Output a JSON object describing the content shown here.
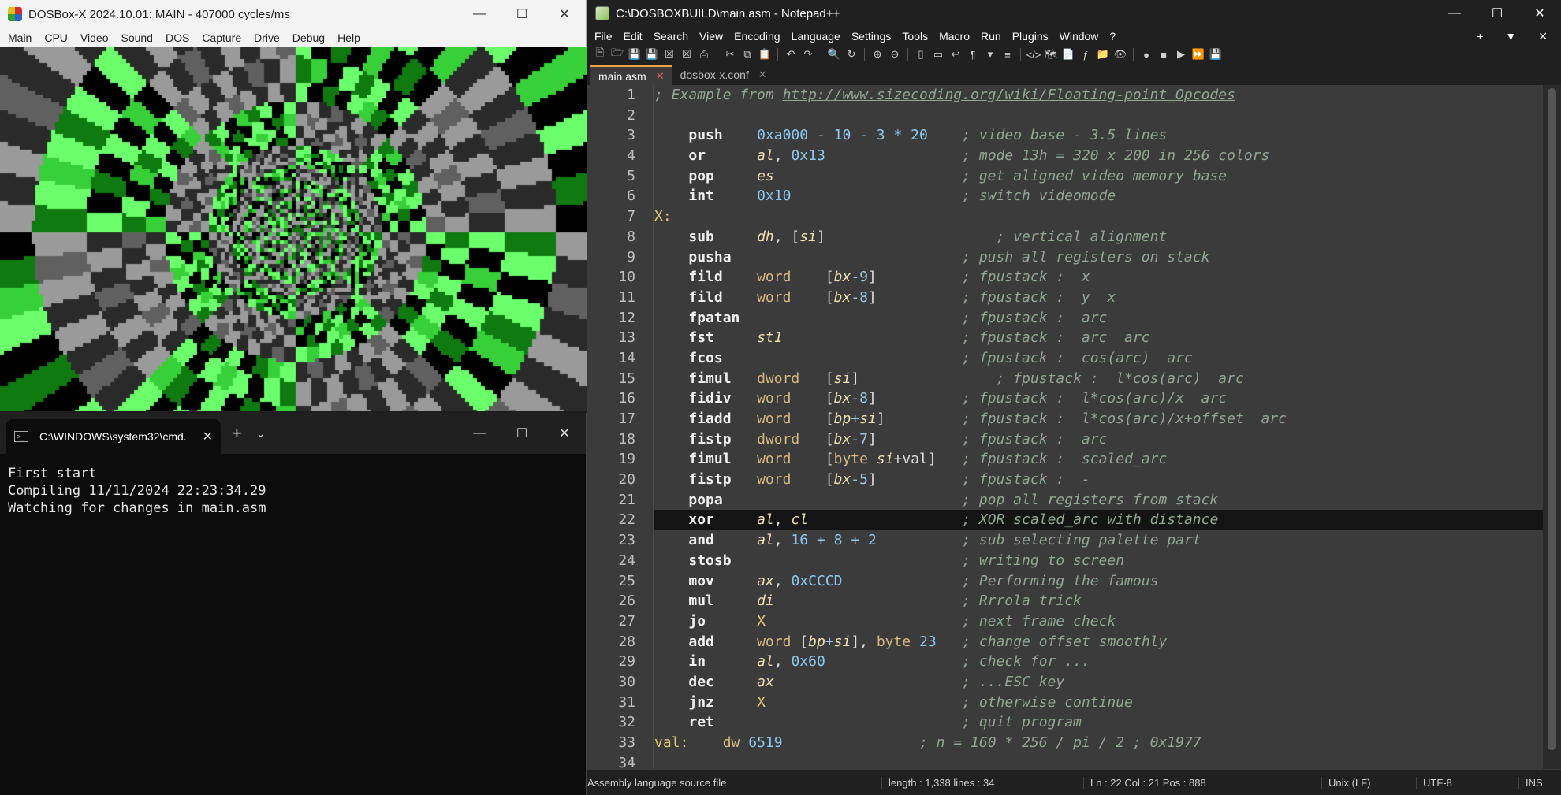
{
  "dosbox": {
    "title": "DOSBox-X 2024.10.01: MAIN - 407000 cycles/ms",
    "menu": [
      "Main",
      "CPU",
      "Video",
      "Sound",
      "DOS",
      "Capture",
      "Drive",
      "Debug",
      "Help"
    ],
    "screen_colors": [
      "#000000",
      "#2a2a2a",
      "#606060",
      "#9a9a9a",
      "#0f7a0f",
      "#38d038",
      "#6cff6c"
    ]
  },
  "cmd": {
    "tab_label": "C:\\WINDOWS\\system32\\cmd.",
    "lines": [
      "First start",
      "",
      "Compiling 11/11/2024 22:23:34.29",
      "Watching for changes in main.asm"
    ]
  },
  "npp": {
    "title": "C:\\DOSBOXBUILD\\main.asm - Notepad++",
    "menu": [
      "File",
      "Edit",
      "Search",
      "View",
      "Encoding",
      "Language",
      "Settings",
      "Tools",
      "Macro",
      "Run",
      "Plugins",
      "Window",
      "?"
    ],
    "tabs": [
      {
        "label": "main.asm",
        "active": true
      },
      {
        "label": "dosbox-x.conf",
        "active": false
      }
    ],
    "current_line": 22,
    "code": [
      [
        [
          "c-cm",
          "; Example from "
        ],
        [
          "c-link",
          "http://www.sizecoding.org/wiki/Floating-point_Opcodes"
        ]
      ],
      [],
      [
        [
          "c-plain",
          "    "
        ],
        [
          "c-ins",
          "push"
        ],
        [
          "c-plain",
          "    "
        ],
        [
          "c-num",
          "0xa000 - 10 - 3 * 20"
        ],
        [
          "c-plain",
          "    "
        ],
        [
          "c-cm",
          "; video base - 3.5 lines"
        ]
      ],
      [
        [
          "c-plain",
          "    "
        ],
        [
          "c-ins",
          "or"
        ],
        [
          "c-plain",
          "      "
        ],
        [
          "c-reg",
          "al"
        ],
        [
          "c-plain",
          ", "
        ],
        [
          "c-num",
          "0x13"
        ],
        [
          "c-plain",
          "                "
        ],
        [
          "c-cm",
          "; mode 13h = 320 x 200 in 256 colors"
        ]
      ],
      [
        [
          "c-plain",
          "    "
        ],
        [
          "c-ins",
          "pop"
        ],
        [
          "c-plain",
          "     "
        ],
        [
          "c-reg",
          "es"
        ],
        [
          "c-plain",
          "                      "
        ],
        [
          "c-cm",
          "; get aligned video memory base"
        ]
      ],
      [
        [
          "c-plain",
          "    "
        ],
        [
          "c-ins",
          "int"
        ],
        [
          "c-plain",
          "     "
        ],
        [
          "c-num",
          "0x10"
        ],
        [
          "c-plain",
          "                    "
        ],
        [
          "c-cm",
          "; switch videomode"
        ]
      ],
      [
        [
          "c-lbl",
          "X:"
        ]
      ],
      [
        [
          "c-plain",
          "    "
        ],
        [
          "c-ins",
          "sub"
        ],
        [
          "c-plain",
          "     "
        ],
        [
          "c-reg",
          "dh"
        ],
        [
          "c-plain",
          ", ["
        ],
        [
          "c-reg",
          "si"
        ],
        [
          "c-plain",
          "]                    "
        ],
        [
          "c-cm",
          "; vertical alignment"
        ]
      ],
      [
        [
          "c-plain",
          "    "
        ],
        [
          "c-ins",
          "pusha"
        ],
        [
          "c-plain",
          "                           "
        ],
        [
          "c-cm",
          "; push all registers on stack"
        ]
      ],
      [
        [
          "c-plain",
          "    "
        ],
        [
          "c-ins",
          "fild"
        ],
        [
          "c-plain",
          "    "
        ],
        [
          "c-kw",
          "word"
        ],
        [
          "c-plain",
          "    ["
        ],
        [
          "c-reg",
          "bx"
        ],
        [
          "c-op",
          "-9"
        ],
        [
          "c-plain",
          "]          "
        ],
        [
          "c-cm",
          "; fpustack :  x"
        ]
      ],
      [
        [
          "c-plain",
          "    "
        ],
        [
          "c-ins",
          "fild"
        ],
        [
          "c-plain",
          "    "
        ],
        [
          "c-kw",
          "word"
        ],
        [
          "c-plain",
          "    ["
        ],
        [
          "c-reg",
          "bx"
        ],
        [
          "c-op",
          "-8"
        ],
        [
          "c-plain",
          "]          "
        ],
        [
          "c-cm",
          "; fpustack :  y  x"
        ]
      ],
      [
        [
          "c-plain",
          "    "
        ],
        [
          "c-ins",
          "fpatan"
        ],
        [
          "c-plain",
          "                          "
        ],
        [
          "c-cm",
          "; fpustack :  arc"
        ]
      ],
      [
        [
          "c-plain",
          "    "
        ],
        [
          "c-ins",
          "fst"
        ],
        [
          "c-plain",
          "     "
        ],
        [
          "c-reg",
          "st1"
        ],
        [
          "c-plain",
          "                     "
        ],
        [
          "c-cm",
          "; fpustack :  arc  arc"
        ]
      ],
      [
        [
          "c-plain",
          "    "
        ],
        [
          "c-ins",
          "fcos"
        ],
        [
          "c-plain",
          "                            "
        ],
        [
          "c-cm",
          "; fpustack :  cos(arc)  arc"
        ]
      ],
      [
        [
          "c-plain",
          "    "
        ],
        [
          "c-ins",
          "fimul"
        ],
        [
          "c-plain",
          "   "
        ],
        [
          "c-kw",
          "dword"
        ],
        [
          "c-plain",
          "   ["
        ],
        [
          "c-reg",
          "si"
        ],
        [
          "c-plain",
          "]                "
        ],
        [
          "c-cm",
          "; fpustack :  l*cos(arc)  arc"
        ]
      ],
      [
        [
          "c-plain",
          "    "
        ],
        [
          "c-ins",
          "fidiv"
        ],
        [
          "c-plain",
          "   "
        ],
        [
          "c-kw",
          "word"
        ],
        [
          "c-plain",
          "    ["
        ],
        [
          "c-reg",
          "bx"
        ],
        [
          "c-op",
          "-8"
        ],
        [
          "c-plain",
          "]          "
        ],
        [
          "c-cm",
          "; fpustack :  l*cos(arc)/x  arc"
        ]
      ],
      [
        [
          "c-plain",
          "    "
        ],
        [
          "c-ins",
          "fiadd"
        ],
        [
          "c-plain",
          "   "
        ],
        [
          "c-kw",
          "word"
        ],
        [
          "c-plain",
          "    ["
        ],
        [
          "c-reg",
          "bp"
        ],
        [
          "c-op",
          "+"
        ],
        [
          "c-reg",
          "si"
        ],
        [
          "c-plain",
          "]         "
        ],
        [
          "c-cm",
          "; fpustack :  l*cos(arc)/x+offset  arc"
        ]
      ],
      [
        [
          "c-plain",
          "    "
        ],
        [
          "c-ins",
          "fistp"
        ],
        [
          "c-plain",
          "   "
        ],
        [
          "c-kw",
          "dword"
        ],
        [
          "c-plain",
          "   ["
        ],
        [
          "c-reg",
          "bx"
        ],
        [
          "c-op",
          "-7"
        ],
        [
          "c-plain",
          "]          "
        ],
        [
          "c-cm",
          "; fpustack :  arc"
        ]
      ],
      [
        [
          "c-plain",
          "    "
        ],
        [
          "c-ins",
          "fimul"
        ],
        [
          "c-plain",
          "   "
        ],
        [
          "c-kw",
          "word"
        ],
        [
          "c-plain",
          "    ["
        ],
        [
          "c-kw",
          "byte"
        ],
        [
          "c-plain",
          " "
        ],
        [
          "c-reg",
          "si"
        ],
        [
          "c-plain",
          "+val]   "
        ],
        [
          "c-cm",
          "; fpustack :  scaled_arc"
        ]
      ],
      [
        [
          "c-plain",
          "    "
        ],
        [
          "c-ins",
          "fistp"
        ],
        [
          "c-plain",
          "   "
        ],
        [
          "c-kw",
          "word"
        ],
        [
          "c-plain",
          "    ["
        ],
        [
          "c-reg",
          "bx"
        ],
        [
          "c-op",
          "-5"
        ],
        [
          "c-plain",
          "]          "
        ],
        [
          "c-cm",
          "; fpustack :  -"
        ]
      ],
      [
        [
          "c-plain",
          "    "
        ],
        [
          "c-ins",
          "popa"
        ],
        [
          "c-plain",
          "                            "
        ],
        [
          "c-cm",
          "; pop all registers from stack"
        ]
      ],
      [
        [
          "c-plain",
          "    "
        ],
        [
          "c-ins",
          "xor"
        ],
        [
          "c-plain",
          "     "
        ],
        [
          "c-reg",
          "al"
        ],
        [
          "c-plain",
          ", "
        ],
        [
          "c-reg",
          "cl"
        ],
        [
          "c-plain",
          "                  "
        ],
        [
          "c-cm",
          "; XOR scaled_arc with distance"
        ]
      ],
      [
        [
          "c-plain",
          "    "
        ],
        [
          "c-ins",
          "and"
        ],
        [
          "c-plain",
          "     "
        ],
        [
          "c-reg",
          "al"
        ],
        [
          "c-plain",
          ", "
        ],
        [
          "c-num",
          "16 + 8 + 2"
        ],
        [
          "c-plain",
          "          "
        ],
        [
          "c-cm",
          "; sub selecting palette part"
        ]
      ],
      [
        [
          "c-plain",
          "    "
        ],
        [
          "c-ins",
          "stosb"
        ],
        [
          "c-plain",
          "                           "
        ],
        [
          "c-cm",
          "; writing to screen"
        ]
      ],
      [
        [
          "c-plain",
          "    "
        ],
        [
          "c-ins",
          "mov"
        ],
        [
          "c-plain",
          "     "
        ],
        [
          "c-reg",
          "ax"
        ],
        [
          "c-plain",
          ", "
        ],
        [
          "c-num",
          "0xCCCD"
        ],
        [
          "c-plain",
          "              "
        ],
        [
          "c-cm",
          "; Performing the famous"
        ]
      ],
      [
        [
          "c-plain",
          "    "
        ],
        [
          "c-ins",
          "mul"
        ],
        [
          "c-plain",
          "     "
        ],
        [
          "c-reg",
          "di"
        ],
        [
          "c-plain",
          "                      "
        ],
        [
          "c-cm",
          "; Rrrola trick"
        ]
      ],
      [
        [
          "c-plain",
          "    "
        ],
        [
          "c-ins",
          "jo"
        ],
        [
          "c-plain",
          "      "
        ],
        [
          "c-lbl",
          "X"
        ],
        [
          "c-plain",
          "                       "
        ],
        [
          "c-cm",
          "; next frame check"
        ]
      ],
      [
        [
          "c-plain",
          "    "
        ],
        [
          "c-ins",
          "add"
        ],
        [
          "c-plain",
          "     "
        ],
        [
          "c-kw",
          "word"
        ],
        [
          "c-plain",
          " ["
        ],
        [
          "c-reg",
          "bp"
        ],
        [
          "c-op",
          "+"
        ],
        [
          "c-reg",
          "si"
        ],
        [
          "c-plain",
          "], "
        ],
        [
          "c-kw",
          "byte"
        ],
        [
          "c-plain",
          " "
        ],
        [
          "c-num",
          "23"
        ],
        [
          "c-plain",
          "   "
        ],
        [
          "c-cm",
          "; change offset smoothly"
        ]
      ],
      [
        [
          "c-plain",
          "    "
        ],
        [
          "c-ins",
          "in"
        ],
        [
          "c-plain",
          "      "
        ],
        [
          "c-reg",
          "al"
        ],
        [
          "c-plain",
          ", "
        ],
        [
          "c-num",
          "0x60"
        ],
        [
          "c-plain",
          "                "
        ],
        [
          "c-cm",
          "; check for ..."
        ]
      ],
      [
        [
          "c-plain",
          "    "
        ],
        [
          "c-ins",
          "dec"
        ],
        [
          "c-plain",
          "     "
        ],
        [
          "c-reg",
          "ax"
        ],
        [
          "c-plain",
          "                      "
        ],
        [
          "c-cm",
          "; ...ESC key"
        ]
      ],
      [
        [
          "c-plain",
          "    "
        ],
        [
          "c-ins",
          "jnz"
        ],
        [
          "c-plain",
          "     "
        ],
        [
          "c-lbl",
          "X"
        ],
        [
          "c-plain",
          "                       "
        ],
        [
          "c-cm",
          "; otherwise continue"
        ]
      ],
      [
        [
          "c-plain",
          "    "
        ],
        [
          "c-ins",
          "ret"
        ],
        [
          "c-plain",
          "                             "
        ],
        [
          "c-cm",
          "; quit program"
        ]
      ],
      [
        [
          "c-lbl",
          "val:"
        ],
        [
          "c-plain",
          "    "
        ],
        [
          "c-kw",
          "dw"
        ],
        [
          "c-plain",
          " "
        ],
        [
          "c-num",
          "6519"
        ],
        [
          "c-plain",
          "                "
        ],
        [
          "c-cm",
          "; n = 160 * 256 / pi / 2 ; 0x1977"
        ]
      ],
      []
    ],
    "status": {
      "filetype": "Assembly language source file",
      "length": "length : 1,338    lines : 34",
      "position": "Ln : 22    Col : 21    Pos : 888",
      "eol": "Unix (LF)",
      "encoding": "UTF-8",
      "mode": "INS"
    }
  }
}
